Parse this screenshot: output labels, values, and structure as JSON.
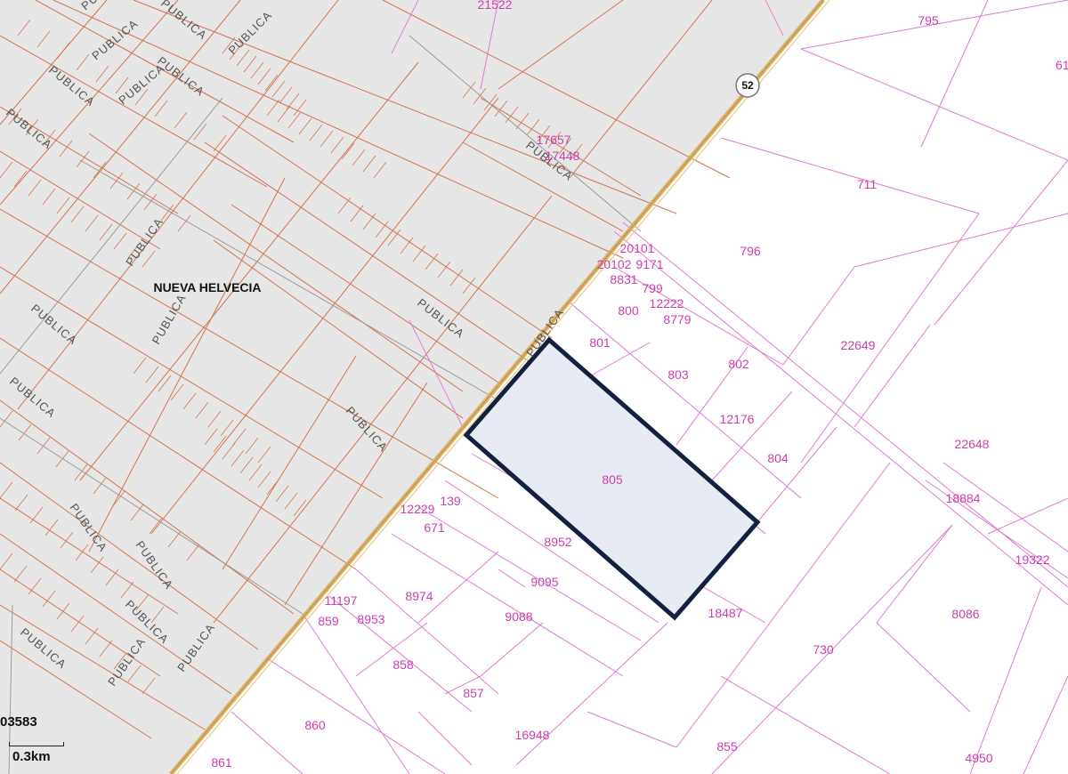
{
  "colors": {
    "urban_fill": "#e6e6e6",
    "urban_lines": "#d0734e",
    "rural_lines": "#e07ad0",
    "label_pink": "#cc3fae",
    "road": "#d8b56a",
    "selection_stroke": "#13203f",
    "selection_fill": "#e8ebf3"
  },
  "map": {
    "town_name": "NUEVA HELVECIA",
    "route_number": "52",
    "street_labels": [
      "PUBLICA",
      "PUBLICA",
      "PUBLICA",
      "PUBLICA",
      "PUBLICA",
      "PUBLICA",
      "PUBLICA",
      "PUBLICA",
      "PUBLICA",
      "PUBLICA",
      "PUBLICA",
      "PUBLICA",
      "PUBLICA",
      "PUBLICA",
      "PUBLICA",
      "PUBLICA",
      "PUBLICA",
      "PUBLICA",
      "PUBLICA",
      "PUBLICA",
      "PUBLICA",
      "PUBLICA"
    ],
    "parcels": [
      "21522",
      "795",
      "711",
      "796",
      "17657",
      "17448",
      "20101",
      "20102",
      "9171",
      "8831",
      "799",
      "800",
      "12222",
      "8779",
      "801",
      "803",
      "802",
      "22649",
      "12176",
      "804",
      "22648",
      "18884",
      "805",
      "12229",
      "139",
      "671",
      "8952",
      "9095",
      "19322",
      "11197",
      "859",
      "8953",
      "8974",
      "9088",
      "18487",
      "730",
      "8086",
      "858",
      "857",
      "860",
      "16948",
      "855",
      "861",
      "4950",
      "61"
    ],
    "selected_parcel": "805"
  },
  "footer": {
    "coordinate": "03583",
    "scale": "0.3km"
  }
}
